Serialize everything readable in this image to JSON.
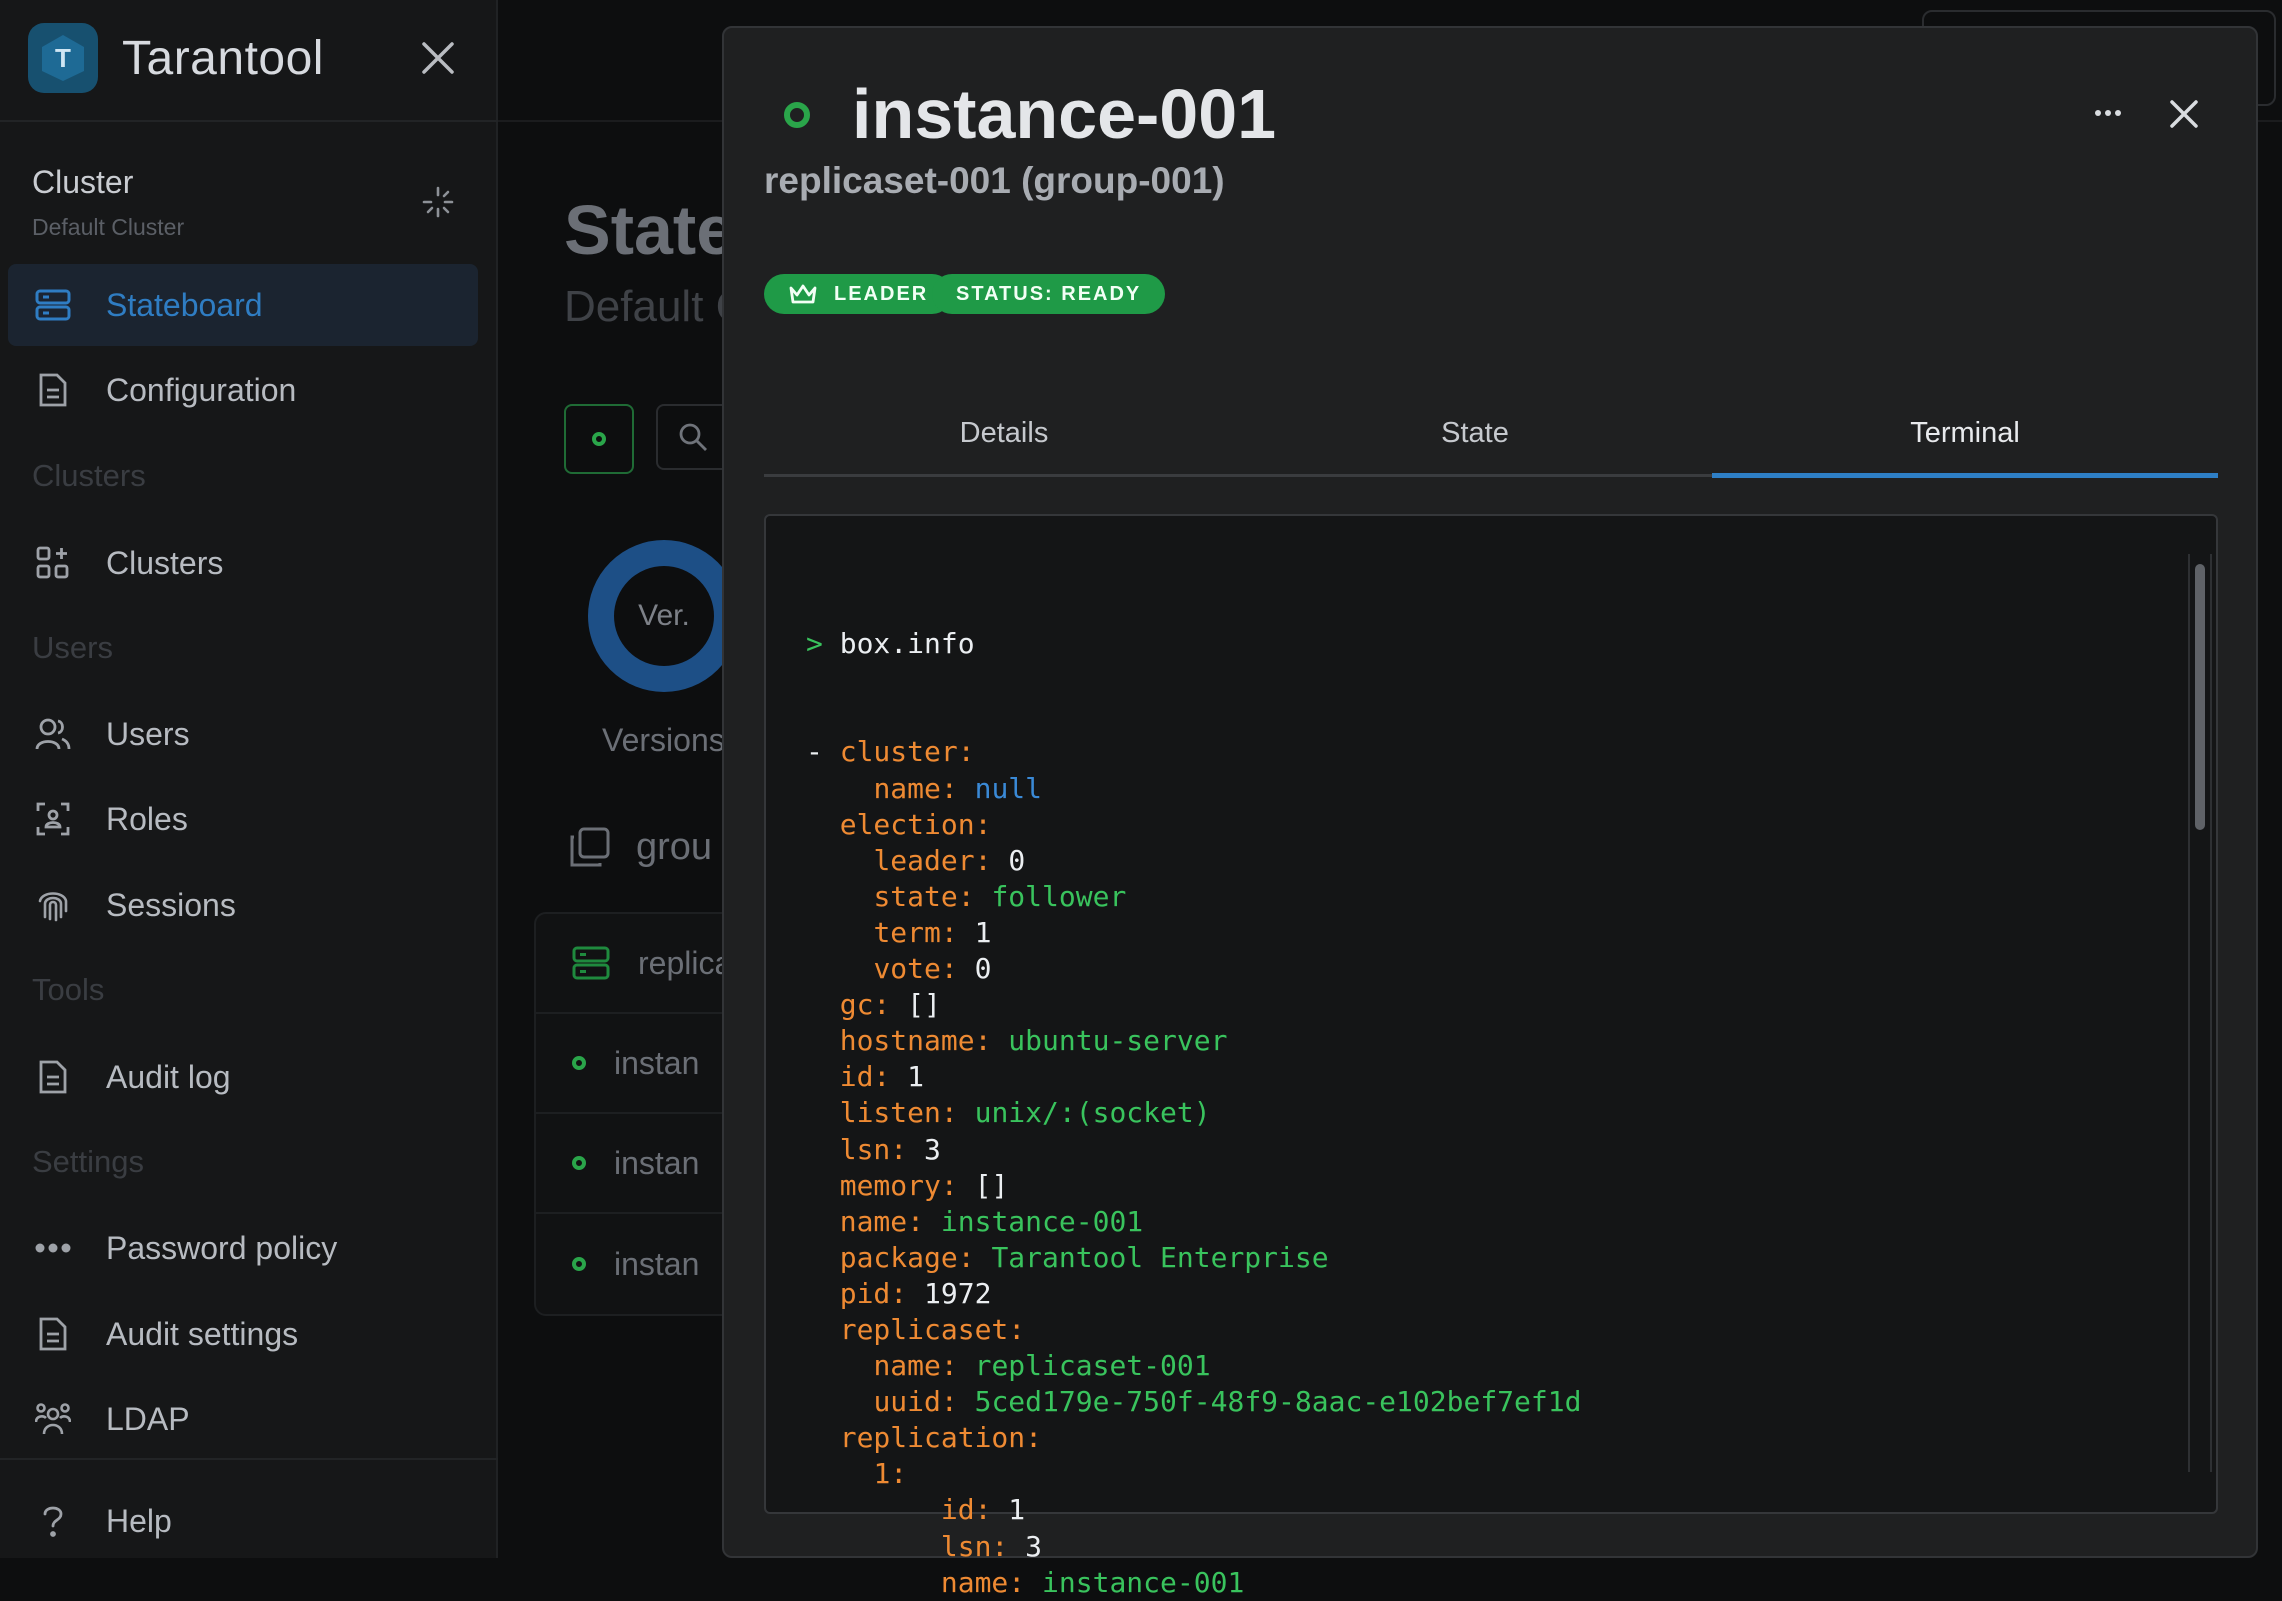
{
  "brand": {
    "name": "Tarantool",
    "logo_letter": "T"
  },
  "sidebar": {
    "cluster_label": "Cluster",
    "cluster_name": "Default Cluster",
    "items": [
      {
        "label": "Stateboard",
        "icon": "server-icon",
        "active": true
      },
      {
        "label": "Configuration",
        "icon": "document-icon"
      },
      {
        "label": "Clusters",
        "icon": "grid-plus-icon"
      },
      {
        "label": "Users",
        "icon": "users-icon"
      },
      {
        "label": "Roles",
        "icon": "role-badge-icon"
      },
      {
        "label": "Sessions",
        "icon": "fingerprint-icon"
      },
      {
        "label": "Audit log",
        "icon": "document-icon"
      },
      {
        "label": "Password policy",
        "icon": "password-dots-icon"
      },
      {
        "label": "Audit settings",
        "icon": "document-icon"
      },
      {
        "label": "LDAP",
        "icon": "team-icon"
      },
      {
        "label": "Help",
        "icon": "question-icon"
      }
    ],
    "sections": {
      "clusters": "Clusters",
      "users": "Users",
      "tools": "Tools",
      "settings": "Settings"
    }
  },
  "background": {
    "title": "State",
    "subtitle": "Default C",
    "donut_label": "Ver.",
    "versions_label": "Versions",
    "group_label": "grou",
    "rows": [
      "replica",
      "instan",
      "instan",
      "instan"
    ]
  },
  "drawer": {
    "title": "instance-001",
    "subtitle": "replicaset-001 (group-001)",
    "badges": {
      "leader": "LEADER",
      "status": "STATUS: READY"
    },
    "tabs": [
      "Details",
      "State",
      "Terminal"
    ],
    "active_tab": "Terminal",
    "colors": {
      "accent": "#2e7fc6",
      "success": "#1f9a47",
      "yaml_key": "#ee8a33",
      "yaml_value": "#39c35d",
      "yaml_null": "#3a89d6"
    }
  },
  "terminal": {
    "prompt": ">",
    "command": "box.info",
    "lines": [
      {
        "indent": "",
        "marker": "- ",
        "key": "cluster:",
        "value": "",
        "vtype": ""
      },
      {
        "indent": "    ",
        "marker": "",
        "key": "name:",
        "value": "null",
        "vtype": "b"
      },
      {
        "indent": "  ",
        "marker": "",
        "key": "election:",
        "value": "",
        "vtype": ""
      },
      {
        "indent": "    ",
        "marker": "",
        "key": "leader:",
        "value": "0",
        "vtype": "n"
      },
      {
        "indent": "    ",
        "marker": "",
        "key": "state:",
        "value": "follower",
        "vtype": "v"
      },
      {
        "indent": "    ",
        "marker": "",
        "key": "term:",
        "value": "1",
        "vtype": "n"
      },
      {
        "indent": "    ",
        "marker": "",
        "key": "vote:",
        "value": "0",
        "vtype": "n"
      },
      {
        "indent": "  ",
        "marker": "",
        "key": "gc:",
        "value": "[]",
        "vtype": "n"
      },
      {
        "indent": "  ",
        "marker": "",
        "key": "hostname:",
        "value": "ubuntu-server",
        "vtype": "v"
      },
      {
        "indent": "  ",
        "marker": "",
        "key": "id:",
        "value": "1",
        "vtype": "n"
      },
      {
        "indent": "  ",
        "marker": "",
        "key": "listen:",
        "value": "unix/:(socket)",
        "vtype": "v"
      },
      {
        "indent": "  ",
        "marker": "",
        "key": "lsn:",
        "value": "3",
        "vtype": "n"
      },
      {
        "indent": "  ",
        "marker": "",
        "key": "memory:",
        "value": "[]",
        "vtype": "n"
      },
      {
        "indent": "  ",
        "marker": "",
        "key": "name:",
        "value": "instance-001",
        "vtype": "v"
      },
      {
        "indent": "  ",
        "marker": "",
        "key": "package:",
        "value": "Tarantool Enterprise",
        "vtype": "v"
      },
      {
        "indent": "  ",
        "marker": "",
        "key": "pid:",
        "value": "1972",
        "vtype": "n"
      },
      {
        "indent": "  ",
        "marker": "",
        "key": "replicaset:",
        "value": "",
        "vtype": ""
      },
      {
        "indent": "    ",
        "marker": "",
        "key": "name:",
        "value": "replicaset-001",
        "vtype": "v"
      },
      {
        "indent": "    ",
        "marker": "",
        "key": "uuid:",
        "value": "5ced179e-750f-48f9-8aac-e102bef7ef1d",
        "vtype": "v"
      },
      {
        "indent": "  ",
        "marker": "",
        "key": "replication:",
        "value": "",
        "vtype": ""
      },
      {
        "indent": "    ",
        "marker": "",
        "key": "1:",
        "value": "",
        "vtype": ""
      },
      {
        "indent": "        ",
        "marker": "",
        "key": "id:",
        "value": "1",
        "vtype": "n"
      },
      {
        "indent": "        ",
        "marker": "",
        "key": "lsn:",
        "value": "3",
        "vtype": "n"
      },
      {
        "indent": "        ",
        "marker": "",
        "key": "name:",
        "value": "instance-001",
        "vtype": "v"
      }
    ],
    "scroll_position": 0.0
  }
}
